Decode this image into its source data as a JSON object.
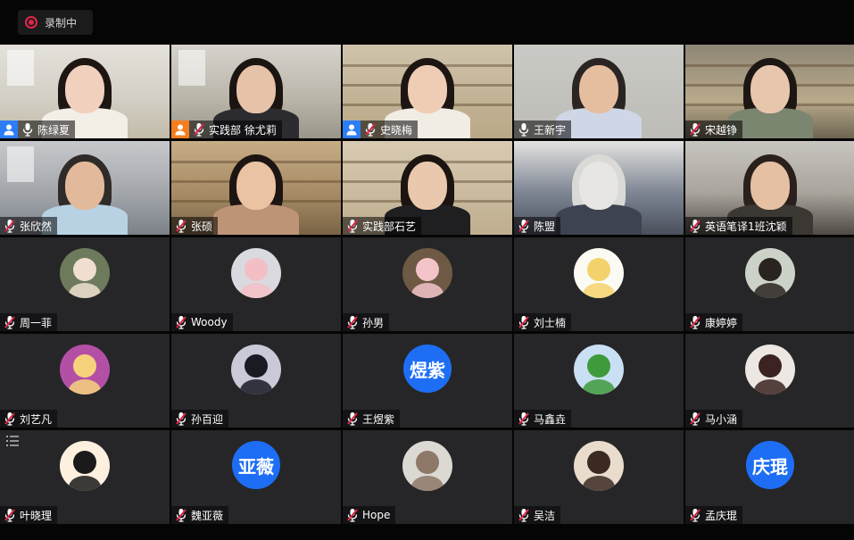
{
  "recording": {
    "label": "录制中"
  },
  "participants": [
    {
      "name": "陈绿夏",
      "host_badge": "blue",
      "mic": "on",
      "video": true,
      "scene": "room-white",
      "active": true,
      "hair": "#1e1612",
      "skin": "#f1d1bd",
      "shirt": "#f3eee6"
    },
    {
      "name": "实践部 徐尤莉",
      "host_badge": "orange",
      "mic": "off",
      "video": true,
      "scene": "office",
      "hair": "#1b1411",
      "skin": "#e6c2a8",
      "shirt": "#2c2c30"
    },
    {
      "name": "史晓梅",
      "host_badge": "blue",
      "mic": "off",
      "video": true,
      "scene": "shelf",
      "hair": "#1c1512",
      "skin": "#efcdb5",
      "shirt": "#f1ece4"
    },
    {
      "name": "王新宇",
      "mic": "on",
      "video": true,
      "scene": "grey-wall",
      "hair": "#2a2523",
      "skin": "#e5bea0",
      "shirt": "#cfd6e6"
    },
    {
      "name": "宋越铮",
      "mic": "off",
      "video": true,
      "scene": "library",
      "hair": "#1d1714",
      "skin": "#e8c6ad",
      "shirt": "#7b8671"
    },
    {
      "name": "张欣然",
      "mic": "off",
      "video": true,
      "scene": "gym",
      "hair": "#2f2b29",
      "skin": "#e2b99b",
      "shirt": "#b8d2e4"
    },
    {
      "name": "张硕",
      "mic": "off",
      "video": true,
      "scene": "cafe",
      "hair": "#1c1512",
      "skin": "#e9c3a3",
      "shirt": "#bd9576"
    },
    {
      "name": "实践部石艺",
      "mic": "off",
      "video": true,
      "scene": "shelf2",
      "hair": "#1b1410",
      "skin": "#eac8ad",
      "shirt": "#1f1f22"
    },
    {
      "name": "陈盟",
      "mic": "off",
      "video": true,
      "scene": "closeup",
      "hair": "#d9d9d6",
      "skin": "#e8e6e2",
      "shirt": "#3d4350"
    },
    {
      "name": "英语笔译1班沈颖",
      "mic": "off",
      "video": true,
      "scene": "dorm",
      "hair": "#2a211c",
      "skin": "#e6c0a2",
      "shirt": "#3b3733"
    },
    {
      "name": "周一菲",
      "mic": "off",
      "video": false,
      "avatar_icon": "dog-photo-icon",
      "avatar_bg": "#6d7a5c",
      "avatar_fg": "#f0dfd0"
    },
    {
      "name": "Woody",
      "mic": "off",
      "video": false,
      "avatar_icon": "pig-doll-icon",
      "avatar_bg": "#d9dadf",
      "avatar_fg": "#f3bfc4"
    },
    {
      "name": "孙男",
      "mic": "off",
      "video": false,
      "avatar_icon": "pig-toy-icon",
      "avatar_bg": "#6e5a44",
      "avatar_fg": "#f2c4c8"
    },
    {
      "name": "刘士楠",
      "mic": "off",
      "video": false,
      "avatar_icon": "anime-boy-icon",
      "avatar_bg": "#fbfbf4",
      "avatar_fg": "#f4d26b"
    },
    {
      "name": "康婷婷",
      "mic": "off",
      "video": false,
      "avatar_icon": "girl-photo-icon",
      "avatar_bg": "#cdd2c9",
      "avatar_fg": "#2a2420"
    },
    {
      "name": "刘艺凡",
      "mic": "off",
      "video": false,
      "avatar_icon": "anime-girl-icon",
      "avatar_bg": "#b44fa6",
      "avatar_fg": "#f6d37b"
    },
    {
      "name": "孙百迎",
      "mic": "off",
      "video": false,
      "avatar_icon": "silhouette-icon",
      "avatar_bg": "#c9c9d8",
      "avatar_fg": "#1a1a24"
    },
    {
      "name": "王煜紫",
      "mic": "off",
      "video": false,
      "avatar_text": "煜紫"
    },
    {
      "name": "马鑫垚",
      "mic": "off",
      "video": false,
      "avatar_icon": "cabbage-icon",
      "avatar_bg": "#c9dff3",
      "avatar_fg": "#3f9a3c"
    },
    {
      "name": "马小涵",
      "mic": "off",
      "video": false,
      "avatar_icon": "woman-photo-icon",
      "avatar_bg": "#ece7e3",
      "avatar_fg": "#3a2320"
    },
    {
      "name": "叶晓理",
      "mic": "off",
      "video": false,
      "avatar_icon": "anime-reader-icon",
      "avatar_bg": "#fdf0df",
      "avatar_fg": "#1a1a1a",
      "list_icon": true
    },
    {
      "name": "魏亚薇",
      "mic": "off",
      "video": false,
      "avatar_text": "亚薇"
    },
    {
      "name": "Hope",
      "mic": "off",
      "video": false,
      "avatar_icon": "kitten-icon",
      "avatar_bg": "#dcd8d2",
      "avatar_fg": "#8e7868"
    },
    {
      "name": "吴洁",
      "mic": "off",
      "video": false,
      "avatar_icon": "girl-smile-icon",
      "avatar_bg": "#e9dccd",
      "avatar_fg": "#3b2a22"
    },
    {
      "name": "孟庆琨",
      "mic": "off",
      "video": false,
      "avatar_text": "庆琨"
    }
  ],
  "colors": {
    "active_border": "#2ecc4a",
    "host_blue": "#2d7df6",
    "host_orange": "#f57d1f",
    "mic_off_red": "#e0264b",
    "avatar_blue": "#1e6ef5",
    "tile_bg": "#262628"
  }
}
